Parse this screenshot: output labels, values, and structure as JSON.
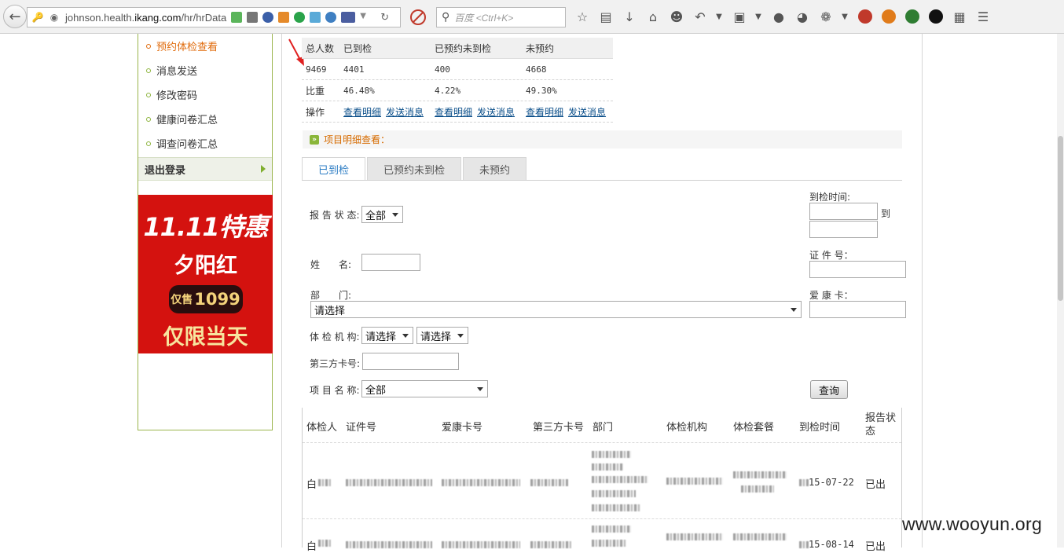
{
  "browser": {
    "url_prefix": "johnson.health.",
    "url_domain": "ikang.com",
    "url_path": "/hr/hrData",
    "search_placeholder": "百度 <Ctrl+K>"
  },
  "sidebar": {
    "items": [
      {
        "label": "预约体检查看",
        "active": true
      },
      {
        "label": "消息发送"
      },
      {
        "label": "修改密码"
      },
      {
        "label": "健康问卷汇总"
      },
      {
        "label": "调查问卷汇总"
      }
    ],
    "logout": "退出登录",
    "promo": {
      "line1": "11.11特惠",
      "line2": "夕阳红",
      "price_prefix": "仅售",
      "price": "1099",
      "line3": "仅限当天"
    }
  },
  "summary": {
    "headers": [
      "总人数",
      "已到检",
      "已预约未到检",
      "未预约"
    ],
    "counts": [
      "9469",
      "4401",
      "400",
      "4668"
    ],
    "ratio_label": "比重",
    "ratios": [
      "46.48%",
      "4.22%",
      "49.30%"
    ],
    "ops_label": "操作",
    "view_link": "查看明细",
    "send_link": "发送消息"
  },
  "detail_title": "项目明细查看：",
  "tabs": [
    "已到检",
    "已预约未到检",
    "未预约"
  ],
  "form": {
    "report_status_label": "报 告 状 态:",
    "report_status_value": "全部",
    "name_label": "姓　　名:",
    "dept_label": "部　　门:",
    "dept_value": "请选择",
    "org_label": "体 检 机 构:",
    "org_value1": "请选择",
    "org_value2": "请选择",
    "third_card_label": "第三方卡号:",
    "item_name_label": "项 目 名 称:",
    "item_name_value": "全部",
    "arrive_time_label": "到检时间:",
    "to_label": "到",
    "id_no_label": "证 件 号：",
    "card_label": "爱 康 卡：",
    "query_button": "查询"
  },
  "results": {
    "headers": [
      "体检人",
      "证件号",
      "爱康卡号",
      "第三方卡号",
      "部门",
      "体检机构",
      "体检套餐",
      "到检时间",
      "报告状态"
    ],
    "rows": [
      {
        "person": "白",
        "date": "15-07-22",
        "status": "已出"
      },
      {
        "person": "白",
        "date": "15-08-14",
        "status": "已出"
      }
    ]
  },
  "watermark": "www.wooyun.org"
}
